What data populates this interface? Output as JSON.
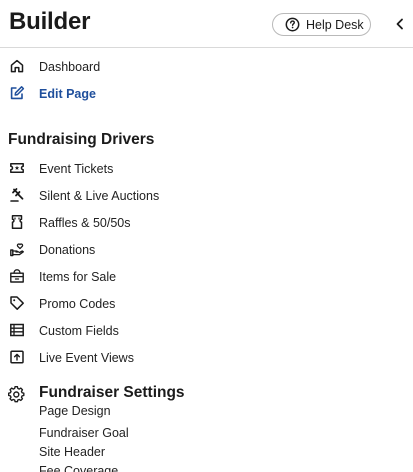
{
  "header": {
    "title": "Builder",
    "help_button_label": "Help Desk"
  },
  "nav": {
    "dashboard": "Dashboard",
    "edit_page": "Edit Page"
  },
  "drivers": {
    "heading": "Fundraising Drivers",
    "items": [
      {
        "label": "Event Tickets",
        "icon": "ticket-icon"
      },
      {
        "label": "Silent & Live Auctions",
        "icon": "gavel-icon"
      },
      {
        "label": "Raffles & 50/50s",
        "icon": "raffle-ticket-icon"
      },
      {
        "label": "Donations",
        "icon": "donation-hand-icon"
      },
      {
        "label": "Items for Sale",
        "icon": "storefront-icon"
      },
      {
        "label": "Promo Codes",
        "icon": "tag-icon"
      },
      {
        "label": "Custom Fields",
        "icon": "list-fields-icon"
      },
      {
        "label": "Live Event Views",
        "icon": "upload-screen-icon"
      }
    ]
  },
  "settings": {
    "heading": "Fundraiser Settings",
    "items": [
      "Page Design",
      "Fundraiser Goal",
      "Site Header",
      "Fee Coverage"
    ]
  },
  "colors": {
    "active": "#1f4f9c",
    "text": "#222222",
    "divider": "#d9d9d9"
  }
}
